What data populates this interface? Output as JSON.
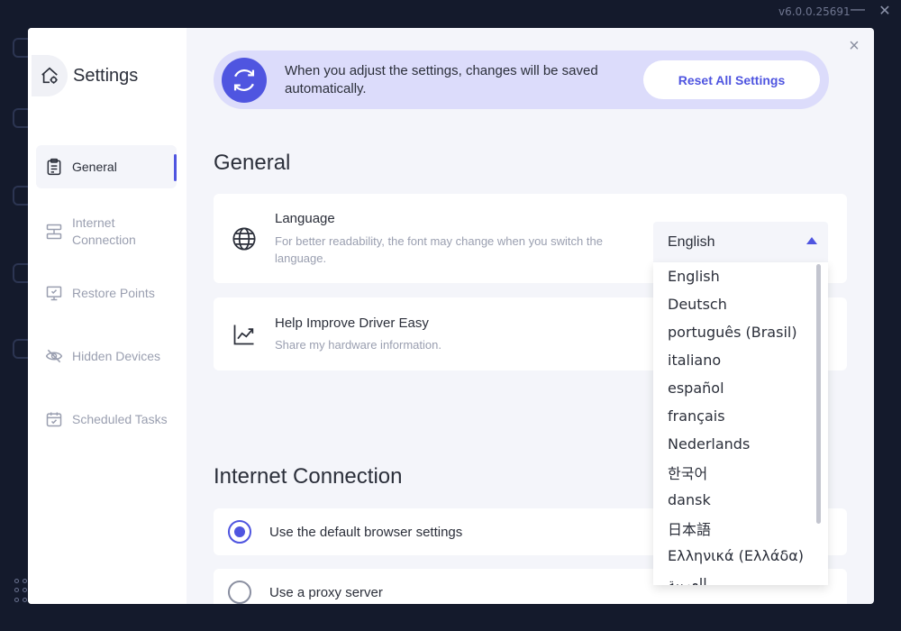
{
  "app": {
    "version": "v6.0.0.25691",
    "minimize_glyph": "—",
    "close_glyph": "✕"
  },
  "settings": {
    "title": "Settings",
    "close_glyph": "×",
    "banner": {
      "text": "When you adjust the settings, changes will be saved automatically.",
      "reset_label": "Reset All Settings"
    },
    "sidebar": {
      "items": [
        {
          "label": "General",
          "icon": "clipboard-icon",
          "active": true
        },
        {
          "label": "Internet Connection",
          "icon": "network-icon",
          "active": false
        },
        {
          "label": "Restore Points",
          "icon": "monitor-check-icon",
          "active": false
        },
        {
          "label": "Hidden Devices",
          "icon": "eye-off-icon",
          "active": false
        },
        {
          "label": "Scheduled Tasks",
          "icon": "calendar-check-icon",
          "active": false
        }
      ]
    },
    "general": {
      "title": "General",
      "language": {
        "title": "Language",
        "description": "For better readability, the font may change when you switch the language.",
        "selected": "English",
        "options": [
          "English",
          "Deutsch",
          "português (Brasil)",
          "italiano",
          "español",
          "français",
          "Nederlands",
          "한국어",
          "dansk",
          "日本語",
          "Ελληνικά (Ελλάδα)",
          "العربية"
        ]
      },
      "help_improve": {
        "title": "Help Improve Driver Easy",
        "description": "Share my hardware information."
      }
    },
    "internet": {
      "title": "Internet Connection",
      "options": [
        {
          "label": "Use the default browser settings",
          "selected": true
        },
        {
          "label": "Use a proxy server",
          "selected": false
        }
      ]
    }
  },
  "colors": {
    "accent": "#4f55e0",
    "banner_bg": "#dcdcfb",
    "backdrop": "#141a2c"
  }
}
